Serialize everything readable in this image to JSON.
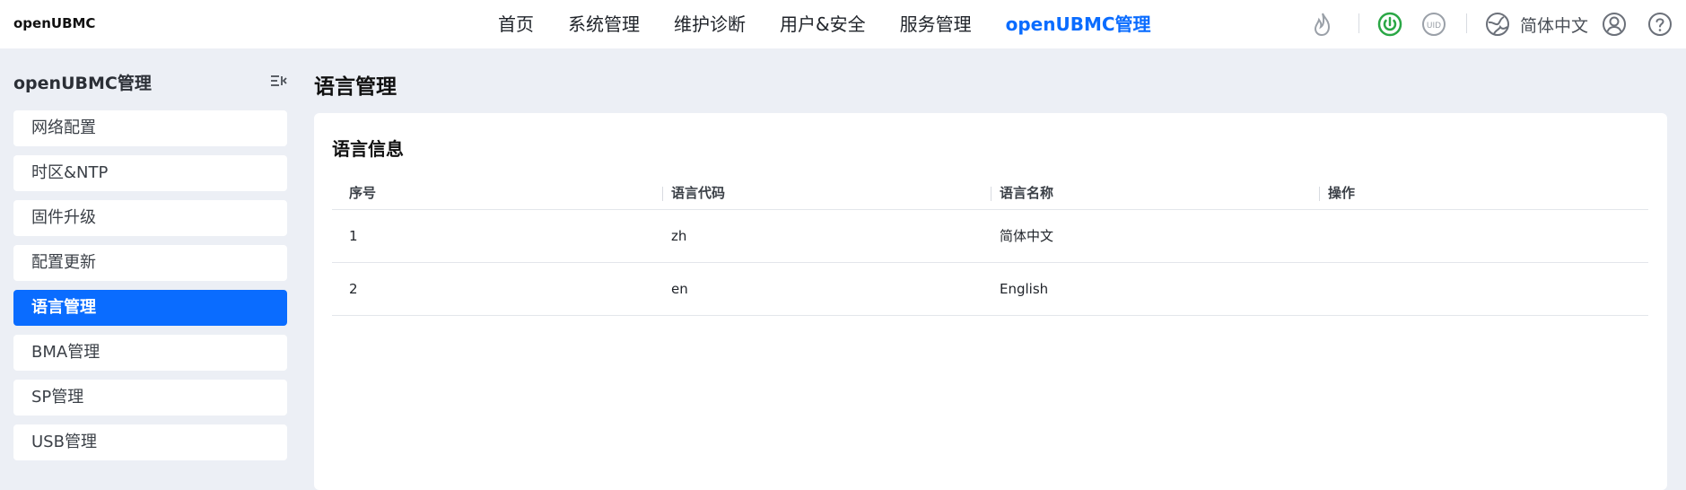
{
  "header": {
    "brand": "openUBMC",
    "nav": [
      "首页",
      "系统管理",
      "维护诊断",
      "用户&安全",
      "服务管理",
      "openUBMC管理"
    ],
    "language": "简体中文",
    "uid_label": "UID"
  },
  "sidebar": {
    "title": "openUBMC管理",
    "items": [
      "网络配置",
      "时区&NTP",
      "固件升级",
      "配置更新",
      "语言管理",
      "BMA管理",
      "SP管理",
      "USB管理"
    ],
    "active_index": 4
  },
  "main": {
    "title": "语言管理",
    "card_title": "语言信息",
    "table": {
      "columns": [
        "序号",
        "语言代码",
        "语言名称",
        "操作"
      ],
      "rows": [
        [
          "1",
          "zh",
          "简体中文",
          ""
        ],
        [
          "2",
          "en",
          "English",
          ""
        ]
      ]
    }
  },
  "colors": {
    "accent": "#0a6cff",
    "power": "#2aa745",
    "background": "#eceff5"
  }
}
